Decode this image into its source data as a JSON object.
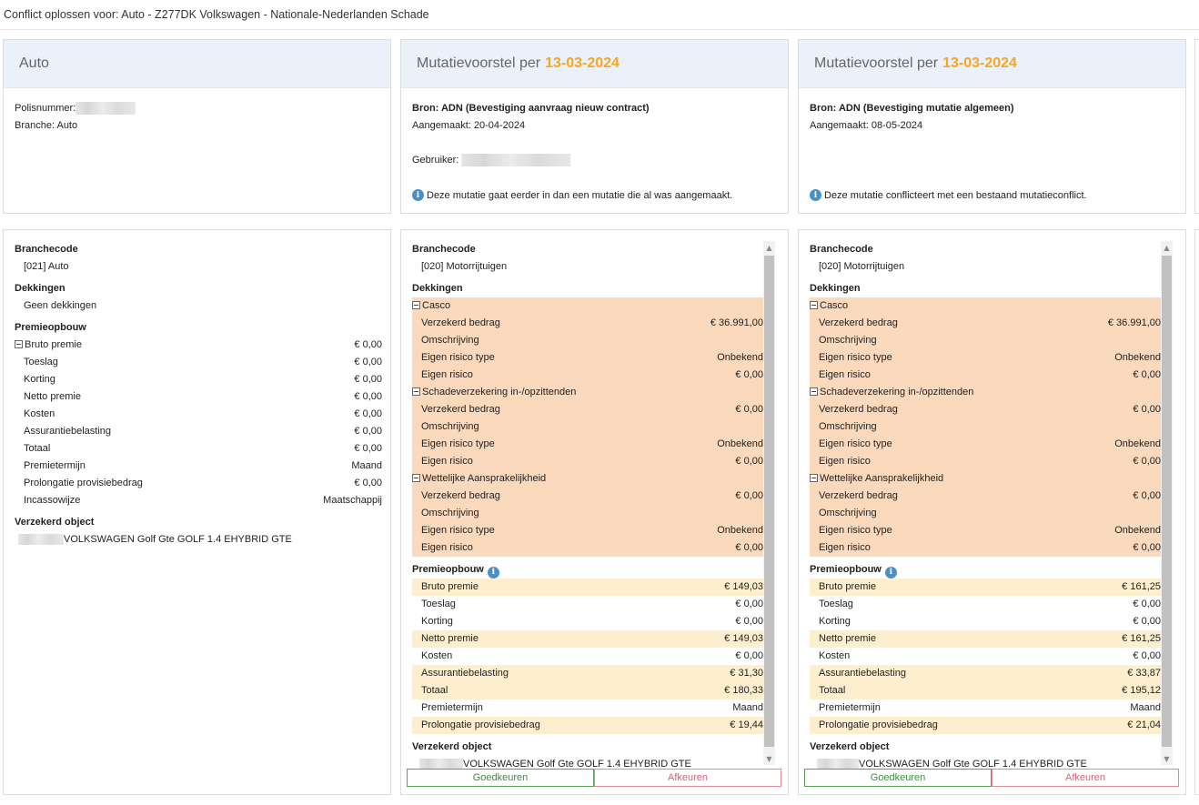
{
  "page_title": "Conflict oplossen voor: Auto - Z277DK Volkswagen - Nationale-Nederlanden Schade",
  "current": {
    "header": "Auto",
    "polis_label": "Polisnummer:",
    "branche_line": "Branche: Auto",
    "branchecode_title": "Branchecode",
    "branchecode": "[021] Auto",
    "dekkingen_title": "Dekkingen",
    "dekkingen_empty": "Geen dekkingen",
    "premie_title": "Premieopbouw",
    "premie_rows": [
      {
        "label": "Bruto premie",
        "value": "€ 0,00"
      },
      {
        "label": "Toeslag",
        "value": "€ 0,00"
      },
      {
        "label": "Korting",
        "value": "€ 0,00"
      },
      {
        "label": "Netto premie",
        "value": "€ 0,00"
      },
      {
        "label": "Kosten",
        "value": "€ 0,00"
      },
      {
        "label": "Assurantiebelasting",
        "value": "€ 0,00"
      },
      {
        "label": "Totaal",
        "value": "€ 0,00"
      },
      {
        "label": "Premietermijn",
        "value": "Maand"
      },
      {
        "label": "Prolongatie provisiebedrag",
        "value": "€ 0,00"
      },
      {
        "label": "Incassowijze",
        "value": "Maatschappij"
      }
    ],
    "object_title": "Verzekerd object",
    "object": "VOLKSWAGEN Golf Gte GOLF 1.4 EHYBRID GTE"
  },
  "proposals": [
    {
      "header_prefix": "Mutatievoorstel per",
      "header_date": "13-03-2024",
      "bron": "Bron: ADN (Bevestiging aanvraag nieuw contract)",
      "aangemaakt": "Aangemaakt: 20-04-2024",
      "gebruiker_label": "Gebruiker:",
      "note": "Deze mutatie gaat eerder in dan een mutatie die al was aangemaakt.",
      "branchecode_title": "Branchecode",
      "branchecode": "[020] Motorrijtuigen",
      "dekkingen_title": "Dekkingen",
      "groups": [
        {
          "name": "Casco",
          "rows": [
            {
              "label": "Verzekerd bedrag",
              "value": "€ 36.991,00"
            },
            {
              "label": "Omschrijving",
              "value": ""
            },
            {
              "label": "Eigen risico type",
              "value": "Onbekend"
            },
            {
              "label": "Eigen risico",
              "value": "€ 0,00"
            }
          ]
        },
        {
          "name": "Schadeverzekering in-/opzittenden",
          "rows": [
            {
              "label": "Verzekerd bedrag",
              "value": "€ 0,00"
            },
            {
              "label": "Omschrijving",
              "value": ""
            },
            {
              "label": "Eigen risico type",
              "value": "Onbekend"
            },
            {
              "label": "Eigen risico",
              "value": "€ 0,00"
            }
          ]
        },
        {
          "name": "Wettelijke Aansprakelijkheid",
          "rows": [
            {
              "label": "Verzekerd bedrag",
              "value": "€ 0,00"
            },
            {
              "label": "Omschrijving",
              "value": ""
            },
            {
              "label": "Eigen risico type",
              "value": "Onbekend"
            },
            {
              "label": "Eigen risico",
              "value": "€ 0,00"
            }
          ]
        }
      ],
      "premie_title": "Premieopbouw",
      "premie_rows": [
        {
          "label": "Bruto premie",
          "value": "€ 149,03",
          "changed": true
        },
        {
          "label": "Toeslag",
          "value": "€ 0,00",
          "changed": false
        },
        {
          "label": "Korting",
          "value": "€ 0,00",
          "changed": false
        },
        {
          "label": "Netto premie",
          "value": "€ 149,03",
          "changed": true
        },
        {
          "label": "Kosten",
          "value": "€ 0,00",
          "changed": false
        },
        {
          "label": "Assurantiebelasting",
          "value": "€ 31,30",
          "changed": true
        },
        {
          "label": "Totaal",
          "value": "€ 180,33",
          "changed": true
        },
        {
          "label": "Premietermijn",
          "value": "Maand",
          "changed": false
        },
        {
          "label": "Prolongatie provisiebedrag",
          "value": "€ 19,44",
          "changed": true
        }
      ],
      "object_title": "Verzekerd object",
      "object": "VOLKSWAGEN Golf Gte GOLF 1.4 EHYBRID GTE",
      "approve_label": "Goedkeuren",
      "reject_label": "Afkeuren"
    },
    {
      "header_prefix": "Mutatievoorstel per",
      "header_date": "13-03-2024",
      "bron": "Bron: ADN (Bevestiging mutatie algemeen)",
      "aangemaakt": "Aangemaakt: 08-05-2024",
      "note": "Deze mutatie conflicteert met een bestaand mutatieconflict.",
      "branchecode_title": "Branchecode",
      "branchecode": "[020] Motorrijtuigen",
      "dekkingen_title": "Dekkingen",
      "groups": [
        {
          "name": "Casco",
          "rows": [
            {
              "label": "Verzekerd bedrag",
              "value": "€ 36.991,00"
            },
            {
              "label": "Omschrijving",
              "value": ""
            },
            {
              "label": "Eigen risico type",
              "value": "Onbekend"
            },
            {
              "label": "Eigen risico",
              "value": "€ 0,00"
            }
          ]
        },
        {
          "name": "Schadeverzekering in-/opzittenden",
          "rows": [
            {
              "label": "Verzekerd bedrag",
              "value": "€ 0,00"
            },
            {
              "label": "Omschrijving",
              "value": ""
            },
            {
              "label": "Eigen risico type",
              "value": "Onbekend"
            },
            {
              "label": "Eigen risico",
              "value": "€ 0,00"
            }
          ]
        },
        {
          "name": "Wettelijke Aansprakelijkheid",
          "rows": [
            {
              "label": "Verzekerd bedrag",
              "value": "€ 0,00"
            },
            {
              "label": "Omschrijving",
              "value": ""
            },
            {
              "label": "Eigen risico type",
              "value": "Onbekend"
            },
            {
              "label": "Eigen risico",
              "value": "€ 0,00"
            }
          ]
        }
      ],
      "premie_title": "Premieopbouw",
      "premie_rows": [
        {
          "label": "Bruto premie",
          "value": "€ 161,25",
          "changed": true
        },
        {
          "label": "Toeslag",
          "value": "€ 0,00",
          "changed": false
        },
        {
          "label": "Korting",
          "value": "€ 0,00",
          "changed": false
        },
        {
          "label": "Netto premie",
          "value": "€ 161,25",
          "changed": true
        },
        {
          "label": "Kosten",
          "value": "€ 0,00",
          "changed": false
        },
        {
          "label": "Assurantiebelasting",
          "value": "€ 33,87",
          "changed": true
        },
        {
          "label": "Totaal",
          "value": "€ 195,12",
          "changed": true
        },
        {
          "label": "Premietermijn",
          "value": "Maand",
          "changed": false
        },
        {
          "label": "Prolongatie provisiebedrag",
          "value": "€ 21,04",
          "changed": true
        }
      ],
      "object_title": "Verzekerd object",
      "object": "VOLKSWAGEN Golf Gte GOLF 1.4 EHYBRID GTE",
      "approve_label": "Goedkeuren",
      "reject_label": "Afkeuren"
    }
  ],
  "colors": {
    "accent_date": "#f5a623",
    "changed_dekking": "#fbd9bc",
    "changed_premie": "#fdefcd",
    "approve": "#3d8b3d",
    "reject": "#d9607a",
    "header_bg": "#eaf1fa"
  },
  "icons": {
    "info": "info-icon",
    "collapse": "collapse-toggle-icon",
    "scroll_up": "scroll-up-arrow-icon",
    "scroll_down": "scroll-down-arrow-icon"
  }
}
